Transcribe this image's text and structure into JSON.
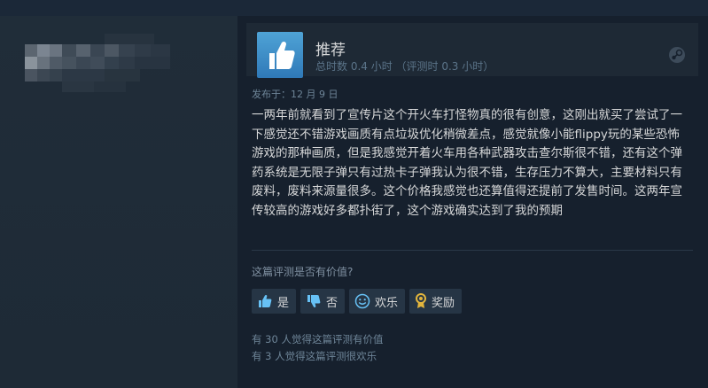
{
  "review": {
    "recommendation": "推荐",
    "hours": "总时数 0.4 小时 （评测时 0.3 小时）",
    "posted": "发布于：12 月 9 日",
    "body": "一两年前就看到了宣传片这个开火车打怪物真的很有创意，这刚出就买了尝试了一下感觉还不错游戏画质有点垃圾优化稍微差点，感觉就像小能flippy玩的某些恐怖游戏的那种画质，但是我感觉开着火车用各种武器攻击查尔斯很不错，还有这个弹药系统是无限子弹只有过热卡子弹我认为很不错，生存压力不算大，主要材料只有废料，废料来源量很多。这个价格我感觉也还算值得还提前了发售时间。这两年宣传较高的游戏好多都扑街了，这个游戏确实达到了我的预期"
  },
  "feedback": {
    "question": "这篇评测是否有价值?",
    "buttons": {
      "yes": "是",
      "no": "否",
      "funny": "欢乐",
      "award": "奖励"
    },
    "helpful_count": "有 30 人觉得这篇评测有价值",
    "funny_count": "有 3 人觉得这篇评测很欢乐"
  },
  "icons": {
    "recommend": "thumbs-up-icon",
    "platform": "steam-icon"
  },
  "colors": {
    "background": "#1b2838",
    "card": "#16202d",
    "thumb_blue": "#4fa3d6",
    "award_gold": "#e2b53d"
  }
}
